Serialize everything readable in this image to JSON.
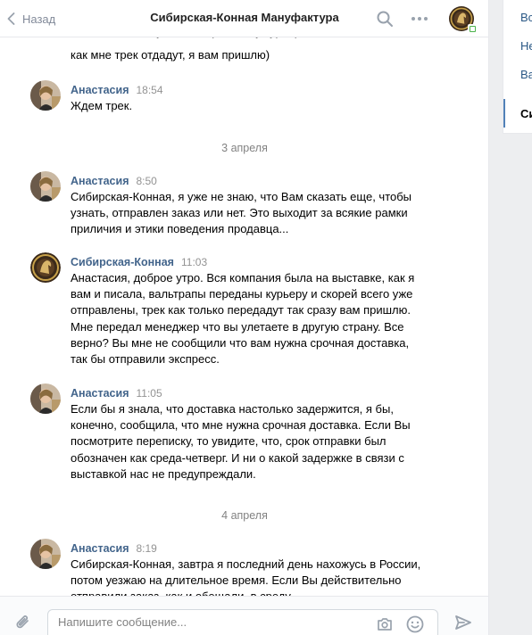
{
  "header": {
    "back_label": "Назад",
    "title": "Сибирская-Конная Мануфактура"
  },
  "partial_message": {
    "line1": "... сейчас нахожусь. Вальтрапы ... у курьера,",
    "line2": "как мне трек отдадут, я вам пришлю)"
  },
  "messages": [
    {
      "author": "Анастасия",
      "time": "18:54",
      "text": "Ждем трек."
    },
    {
      "author": "Анастасия",
      "time": "8:50",
      "text": "Сибирская-Конная, я уже не знаю, что Вам сказать еще, чтобы узнать, отправлен заказ или нет. Это выходит за всякие рамки приличия и этики поведения продавца..."
    },
    {
      "author": "Сибирская-Конная",
      "time": "11:03",
      "text": "Анастасия, доброе утро. Вся компания была на выставке, как я вам и писала, вальтрапы переданы курьеру и скорей всего уже отправлены, трек как только передадут так сразу вам пришлю. Мне передал менеджер что вы улетаете в другую страну. Все верно? Вы мне не сообщили что вам нужна срочная доставка, так бы отправили экспресс."
    },
    {
      "author": "Анастасия",
      "time": "11:05",
      "text": "Если бы я знала, что доставка настолько задержится, я бы, конечно, сообщила, что мне нужна срочная доставка. Если Вы посмотрите переписку, то увидите, что, срок отправки был обозначен как среда-четверг. И ни о какой задержке в связи с выставкой нас не предупреждали."
    },
    {
      "author": "Анастасия",
      "time": "8:19",
      "text": "Сибирская-Конная, завтра я последний день нахожусь в России, потом уезжаю на длительное время. Если Вы действительно отправили заказ, как и обещали, в среду,"
    }
  ],
  "dates": [
    "3 апреля",
    "4 апреля"
  ],
  "composer": {
    "placeholder": "Напишите сообщение..."
  },
  "right_nav": {
    "items": [
      "Вс",
      "Не",
      "Ва",
      "Си"
    ]
  },
  "colors": {
    "link": "#42648b",
    "accent": "#5181b8",
    "online": "#4bb34b"
  }
}
